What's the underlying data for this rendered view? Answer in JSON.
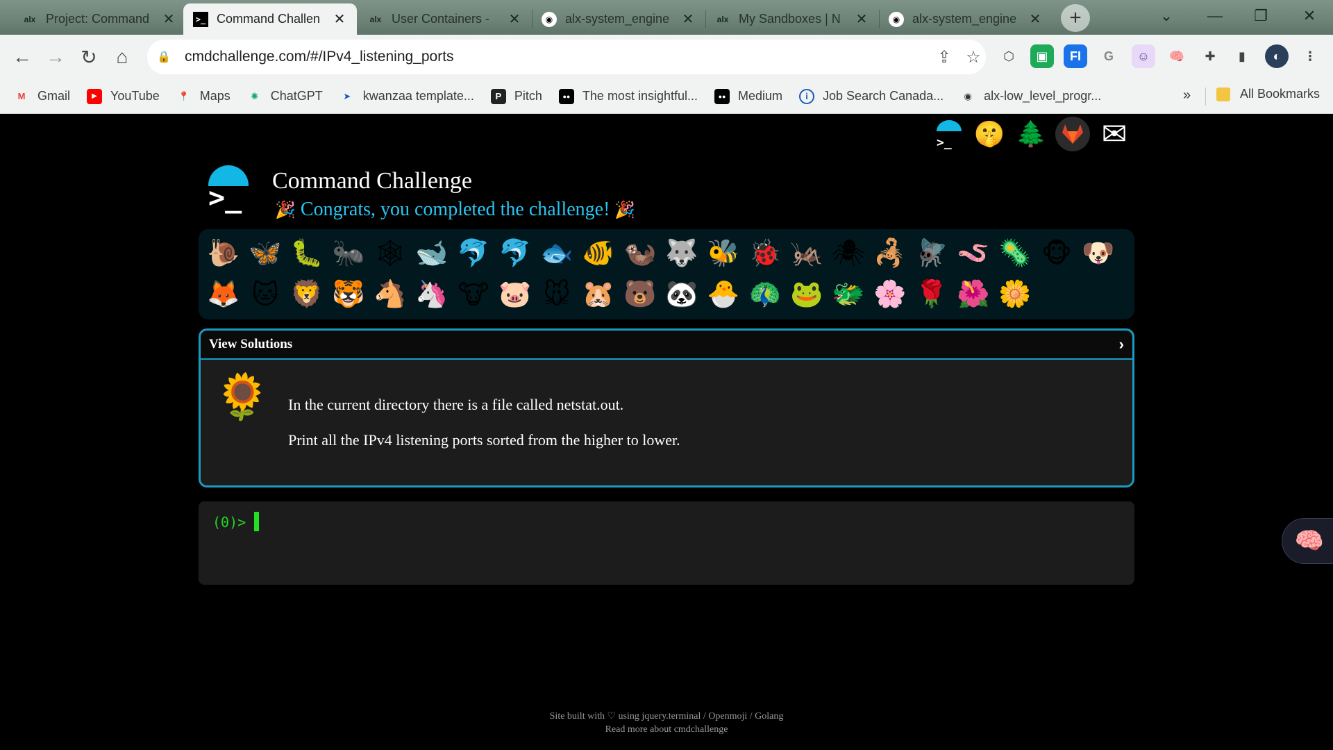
{
  "browser": {
    "tabs": [
      {
        "title": "Project: Command",
        "favicon": "alx",
        "state": "inactive"
      },
      {
        "title": "Command Challen",
        "favicon": ">_",
        "state": "active"
      },
      {
        "title": "User Containers -",
        "favicon": "alx",
        "state": "inactive"
      },
      {
        "title": "alx-system_engine",
        "favicon": "github",
        "state": "inactive"
      },
      {
        "title": "My Sandboxes | N",
        "favicon": "alx",
        "state": "inactive"
      },
      {
        "title": "alx-system_engine",
        "favicon": "github",
        "state": "inactive"
      }
    ],
    "url": "cmdchallenge.com/#/IPv4_listening_ports",
    "bookmarks": [
      {
        "label": "Gmail",
        "icon": "M"
      },
      {
        "label": "YouTube",
        "icon": "▶"
      },
      {
        "label": "Maps",
        "icon": "📍"
      },
      {
        "label": "ChatGPT",
        "icon": "✺"
      },
      {
        "label": "kwanzaa template...",
        "icon": "➤"
      },
      {
        "label": "Pitch",
        "icon": "P"
      },
      {
        "label": "The most insightful...",
        "icon": "●●"
      },
      {
        "label": "Medium",
        "icon": "●●"
      },
      {
        "label": "Job Search Canada...",
        "icon": "i"
      },
      {
        "label": "alx-low_level_progr...",
        "icon": "◉"
      }
    ],
    "bookmarks_more": "»",
    "all_bookmarks": "All Bookmarks"
  },
  "page": {
    "title": "Command Challenge",
    "congrats": "Congrats, you completed the challenge!",
    "congrats_emoji": "🎉",
    "top_icons": [
      {
        "name": "cmdchallenge-logo-icon",
        "glyph": ">_"
      },
      {
        "name": "shushing-face-icon",
        "glyph": "🤫"
      },
      {
        "name": "tree-icon",
        "glyph": "🌲"
      },
      {
        "name": "gitlab-icon",
        "glyph": "🦊"
      },
      {
        "name": "mail-icon",
        "glyph": "✉"
      }
    ],
    "badges": [
      "🐌",
      "🦋",
      "🐛",
      "🐜",
      "🕸",
      "🐋",
      "🐬",
      "🐬",
      "🐟",
      "🐠",
      "🦦",
      "🐺",
      "🐝",
      "🐞",
      "🦗",
      "🕷",
      "🦂",
      "🪰",
      "🪱",
      "🦠",
      "🐵",
      "🐶",
      "🦊",
      "🐱",
      "🦁",
      "🐯",
      "🐴",
      "🦄",
      "🐮",
      "🐷",
      "🐭",
      "🐹",
      "🐻",
      "🐼",
      "🐣",
      "🦚",
      "🐸",
      "🐲",
      "🌸",
      "🌹",
      "🌺",
      "🌼"
    ],
    "panel": {
      "header": "View Solutions",
      "chevron": "›",
      "flower": "🌻",
      "lines": [
        "In the current directory there is a file called netstat.out.",
        "Print all the IPv4 listening ports sorted from the higher to lower."
      ]
    },
    "terminal": {
      "prompt": "(0)>"
    },
    "footer": {
      "line1": "Site built with ♡ using jquery.terminal / Openmoji / Golang",
      "line2": "Read more about cmdchallenge"
    }
  }
}
